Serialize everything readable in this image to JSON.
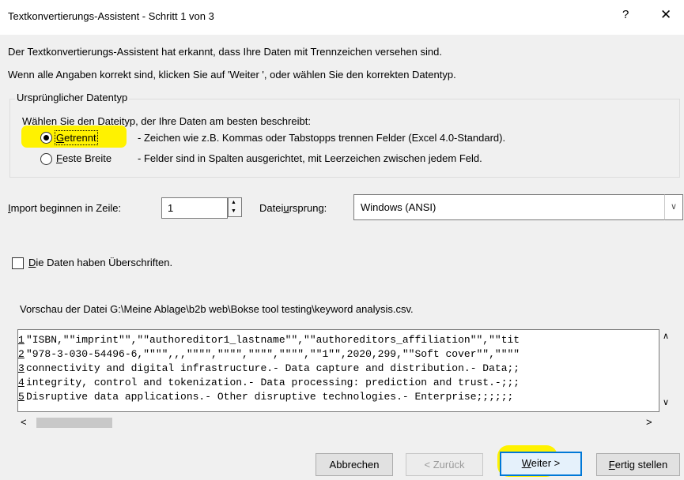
{
  "window": {
    "title": "Textkonvertierungs-Assistent - Schritt 1 von 3",
    "help": "?",
    "close": "✕"
  },
  "intro": {
    "line1": "Der Textkonvertierungs-Assistent hat erkannt, dass Ihre Daten mit Trennzeichen versehen sind.",
    "line2": "Wenn alle Angaben korrekt sind, klicken Sie auf 'Weiter ', oder wählen Sie den korrekten Datentyp."
  },
  "datatype": {
    "group_label": "Ursprünglicher Datentyp",
    "prompt": "Wählen Sie den Dateityp, der Ihre Daten am besten beschreibt:",
    "options": [
      {
        "label": "Getrennt",
        "accel": "G",
        "rest": "etrennt",
        "description": "- Zeichen wie z.B. Kommas oder Tabstopps trennen Felder (Excel 4.0-Standard).",
        "selected": true
      },
      {
        "label": "Feste Breite",
        "accel": "F",
        "rest": "este Breite",
        "description": "- Felder sind in Spalten ausgerichtet, mit Leerzeichen zwischen jedem Feld.",
        "selected": false
      }
    ]
  },
  "import": {
    "start_label_accel": "I",
    "start_label_rest": "mport beginnen in Zeile:",
    "start_value": "1",
    "origin_label_pre": "Datei",
    "origin_label_accel": "u",
    "origin_label_post": "rsprung:",
    "origin_value": "Windows (ANSI)"
  },
  "headers": {
    "accel": "D",
    "rest": "ie Daten haben Überschriften.",
    "checked": false
  },
  "preview": {
    "label": "Vorschau der Datei G:\\Meine Ablage\\b2b web\\Bokse tool testing\\keyword analysis.csv.",
    "rows": [
      {
        "num": "1",
        "text": "\"ISBN,\"\"imprint\"\",\"\"authoreditor1_lastname\"\",\"\"authoreditors_affiliation\"\",\"\"tit"
      },
      {
        "num": "2",
        "text": "\"978-3-030-54496-6,\"\"\"\",,,\"\"\"\",\"\"\"\",\"\"\"\",\"\"\"\",\"\"1\"\",2020,299,\"\"Soft cover\"\",\"\"\"\""
      },
      {
        "num": "3",
        "text": "connectivity and digital infrastructure.- Data capture and distribution.- Data;;"
      },
      {
        "num": "4",
        "text": "integrity, control and tokenization.- Data processing: prediction and trust.-;;;"
      },
      {
        "num": "5",
        "text": "Disruptive data applications.- Other disruptive technologies.- Enterprise;;;;;;"
      }
    ]
  },
  "buttons": {
    "cancel": "Abbrechen",
    "back": "< Zurück",
    "next_accel": "W",
    "next_rest": "eiter >",
    "finish_accel": "F",
    "finish_rest": "ertig stellen"
  }
}
